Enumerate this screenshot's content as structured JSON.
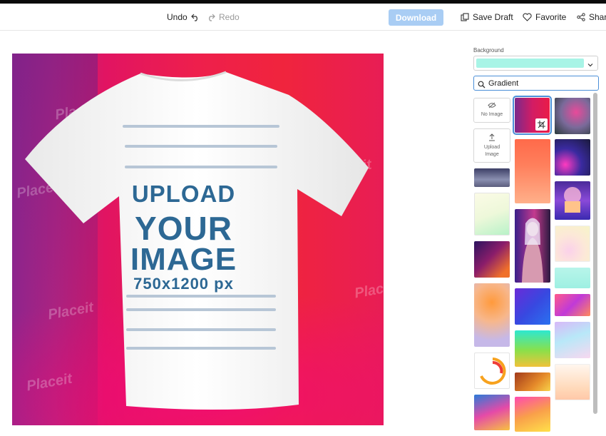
{
  "toolbar": {
    "undo_label": "Undo",
    "redo_label": "Redo",
    "download_label": "Download",
    "save_draft_label": "Save Draft",
    "favorite_label": "Favorite",
    "share_label": "Share",
    "download_color": "#a9cdf4"
  },
  "canvas": {
    "line1": "UPLOAD",
    "line2": "YOUR",
    "line3": "IMAGE",
    "line4": "750x1200 px",
    "watermark": "Placeit",
    "text_color": "#2d6894"
  },
  "panel": {
    "background_label": "Background",
    "selected_color": "#a8f4e6",
    "search_value": "Gradient",
    "no_image_label": "No Image",
    "upload_image_label": "Upload Image"
  },
  "icons": [
    "undo-icon",
    "redo-icon",
    "save-draft-icon",
    "heart-icon",
    "share-icon",
    "chevron-down-icon",
    "search-icon",
    "no-image-icon",
    "upload-icon",
    "crop-icon"
  ]
}
